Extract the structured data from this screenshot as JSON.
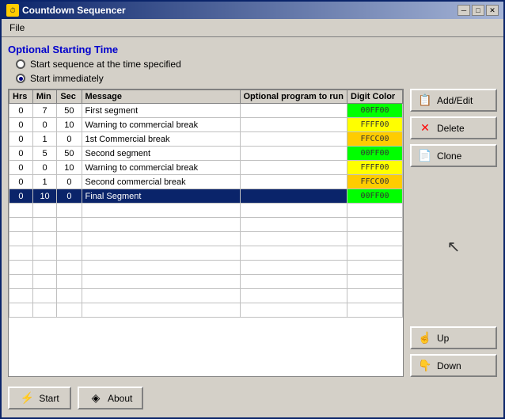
{
  "window": {
    "title": "Countdown Sequencer",
    "icon": "⏱"
  },
  "titleButtons": {
    "minimize": "─",
    "maximize": "□",
    "close": "✕"
  },
  "menu": {
    "items": [
      "File"
    ]
  },
  "optionalTime": {
    "label": "Optional Starting Time",
    "options": [
      {
        "label": "Start sequence at the time specified",
        "selected": false
      },
      {
        "label": "Start immediately",
        "selected": true
      }
    ]
  },
  "table": {
    "columns": [
      "Hrs",
      "Min",
      "Sec",
      "Message",
      "Optional program to run",
      "Digit Color"
    ],
    "rows": [
      {
        "hrs": 0,
        "min": 7,
        "sec": 50,
        "message": "First segment",
        "program": "",
        "color": "00FF00",
        "selected": false
      },
      {
        "hrs": 0,
        "min": 0,
        "sec": 10,
        "message": "Warning to commercial break",
        "program": "",
        "color": "FFFF00",
        "selected": false
      },
      {
        "hrs": 0,
        "min": 1,
        "sec": 0,
        "message": "1st Commercial break",
        "program": "",
        "color": "FFCC00",
        "selected": false
      },
      {
        "hrs": 0,
        "min": 5,
        "sec": 50,
        "message": "Second segment",
        "program": "",
        "color": "00FF00",
        "selected": false
      },
      {
        "hrs": 0,
        "min": 0,
        "sec": 10,
        "message": "Warning to commercial break",
        "program": "",
        "color": "FFFF00",
        "selected": false
      },
      {
        "hrs": 0,
        "min": 1,
        "sec": 0,
        "message": "Second commercial break",
        "program": "",
        "color": "FFCC00",
        "selected": false
      },
      {
        "hrs": 0,
        "min": 10,
        "sec": 0,
        "message": "Final Segment",
        "program": "",
        "color": "00FF00",
        "selected": true
      }
    ],
    "emptyRows": 8
  },
  "buttons": {
    "addEdit": "Add/Edit",
    "delete": "Delete",
    "clone": "Clone",
    "up": "Up",
    "down": "Down",
    "start": "Start",
    "about": "About"
  }
}
